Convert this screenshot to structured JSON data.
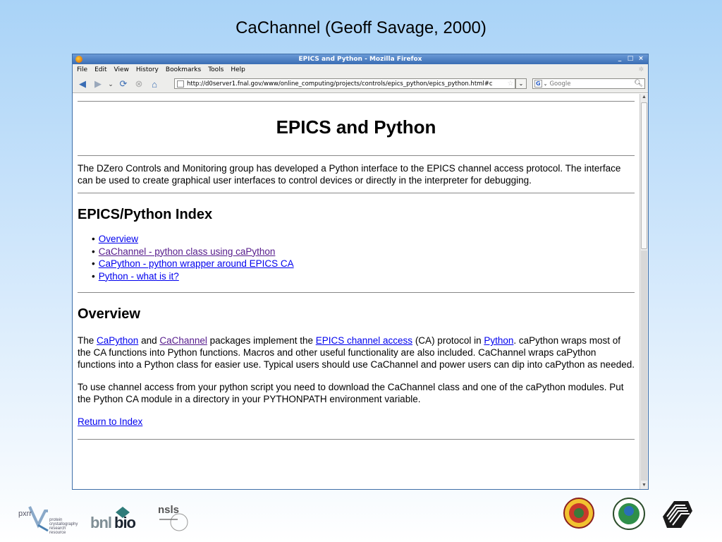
{
  "slide": {
    "title": "CaChannel (Geoff Savage, 2000)"
  },
  "window": {
    "title": "EPICS and Python - Mozilla Firefox",
    "buttons": {
      "minimize": "_",
      "maximize": "□",
      "close": "×"
    }
  },
  "menu": [
    {
      "label": "File"
    },
    {
      "label": "Edit"
    },
    {
      "label": "View"
    },
    {
      "label": "History"
    },
    {
      "label": "Bookmarks"
    },
    {
      "label": "Tools"
    },
    {
      "label": "Help"
    }
  ],
  "nav": {
    "url": "http://d0server1.fnal.gov/www/online_computing/projects/controls/epics_python/epics_python.html#c",
    "search_engine": "G",
    "search_placeholder": "Google"
  },
  "page": {
    "heading": "EPICS and Python",
    "intro": "The DZero Controls and Monitoring group has developed a Python interface to the EPICS channel access protocol. The interface can be used to create graphical user interfaces to control devices or directly in the interpreter for debugging.",
    "index_heading": "EPICS/Python Index",
    "index_items": [
      {
        "label": "Overview",
        "visited": false
      },
      {
        "label": "CaChannel - python class using caPython",
        "visited": true
      },
      {
        "label": "CaPython - python wrapper around EPICS CA",
        "visited": false
      },
      {
        "label": "Python - what is it?",
        "visited": false
      }
    ],
    "overview_heading": "Overview",
    "overview_p1": {
      "t1": "The ",
      "l1": "CaPython",
      "t2": " and ",
      "l2": "CaChannel",
      "t3": " packages implement the ",
      "l3": "EPICS channel access",
      "t4": " (CA) protocol in ",
      "l4": "Python",
      "t5": ". caPython wraps most of the CA functions into Python functions. Macros and other useful functionality are also included. CaChannel wraps caPython functions into a Python class for easier use. Typical users should use CaChannel and power users can dip into caPython as needed."
    },
    "overview_p2": "To use channel access from your python script you need to download the CaChannel class and one of the caPython modules. Put the Python CA module in a directory in your PYTHONPATH environment variable.",
    "return_link": "Return to Index"
  },
  "footer": {
    "pxrr": {
      "mark": "pxrr",
      "line1": "protein",
      "line2": "crystallography",
      "line3": "research resource"
    },
    "bnlbio": {
      "part1": "bnl",
      "part2": "bio"
    },
    "nsls": {
      "mark": "nsls"
    }
  },
  "colors": {
    "link": "#0000ee",
    "visited": "#551a8b",
    "titlebar": "#3a6db4"
  }
}
